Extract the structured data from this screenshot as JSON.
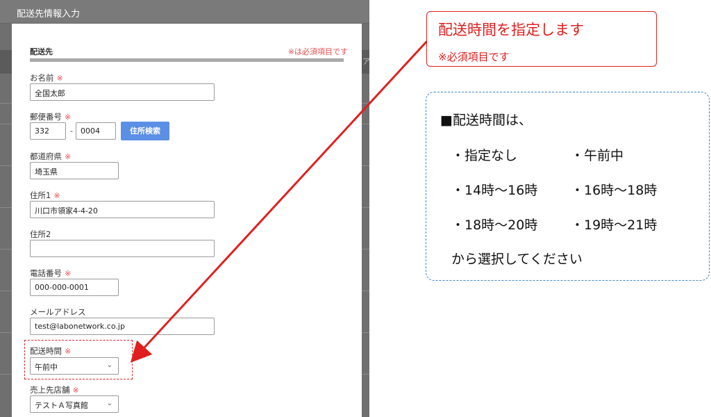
{
  "modal": {
    "title": "配送先情報入力",
    "background_hint": "ア"
  },
  "section": {
    "title": "配送先",
    "required_note": "※は必須項目です"
  },
  "required_mark": "※",
  "fields": {
    "name": {
      "label": "お名前",
      "value": "全国太郎"
    },
    "postal": {
      "label": "郵便番号",
      "value1": "332",
      "separator": "-",
      "value2": "0004",
      "search_button": "住所検索"
    },
    "prefecture": {
      "label": "都道府県",
      "value": "埼玉県"
    },
    "address1": {
      "label": "住所1",
      "value": "川口市領家4-4-20"
    },
    "address2": {
      "label": "住所2",
      "value": ""
    },
    "phone": {
      "label": "電話番号",
      "value": "000-000-0001"
    },
    "email": {
      "label": "メールアドレス",
      "value": "test@labonetwork.co.jp"
    },
    "delivery_time": {
      "label": "配送時間",
      "selected": "午前中"
    },
    "store": {
      "label": "売上先店舗",
      "selected": "テストＡ写真館"
    }
  },
  "callout": {
    "main": "配送時間を指定します",
    "sub": "※必須項目です"
  },
  "info": {
    "heading": "■配送時間は、",
    "options": [
      "・指定なし",
      "・午前中",
      "・14時～16時",
      "・16時～18時",
      "・18時～20時",
      "・19時～21時"
    ],
    "footer": "から選択してください"
  },
  "colors": {
    "accent_red": "#e02020",
    "button_blue": "#5b8fe6",
    "info_border_blue": "#3c86c6"
  }
}
